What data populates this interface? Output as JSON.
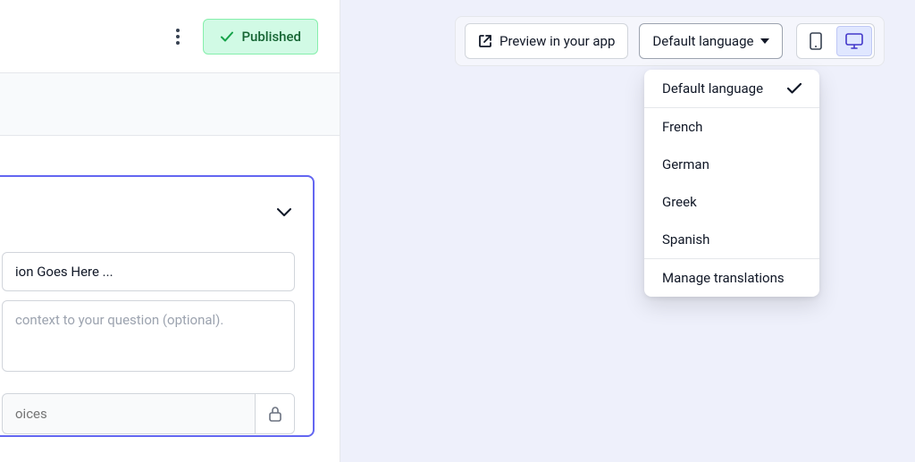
{
  "left": {
    "status_label": "Published",
    "question_value": "ion Goes Here ...",
    "context_placeholder": "context to your question (optional).",
    "choices_placeholder": "oices"
  },
  "toolbar": {
    "preview_label": "Preview in your app",
    "language_label": "Default language"
  },
  "dropdown": {
    "selected": "Default language",
    "languages": [
      "French",
      "German",
      "Greek",
      "Spanish"
    ],
    "manage_label": "Manage translations"
  }
}
